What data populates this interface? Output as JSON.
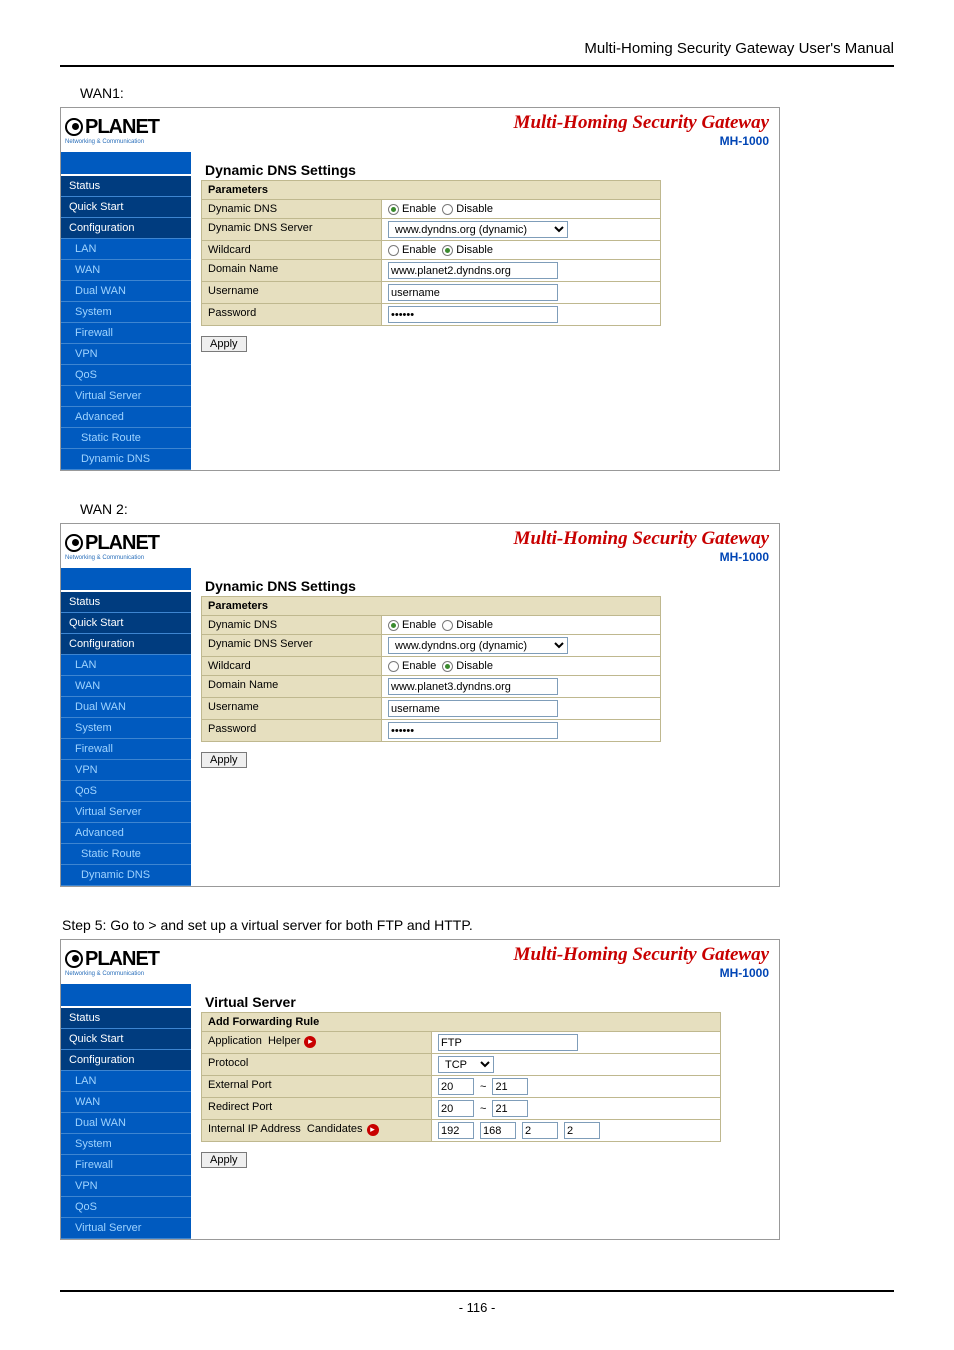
{
  "doc": {
    "header": "Multi-Homing Security Gateway User's Manual",
    "footer": "- 116 -"
  },
  "product": {
    "brand": "PLANET",
    "tagline": "Networking & Communication",
    "title": "Multi-Homing Security Gateway",
    "model": "MH-1000"
  },
  "nav": {
    "status": "Status",
    "quickstart": "Quick Start",
    "configuration": "Configuration",
    "lan": "LAN",
    "wan": "WAN",
    "dualwan": "Dual WAN",
    "system": "System",
    "firewall": "Firewall",
    "vpn": "VPN",
    "qos": "QoS",
    "virtualserver": "Virtual Server",
    "advanced": "Advanced",
    "staticroute": "Static Route",
    "dynamicdns": "Dynamic DNS"
  },
  "labels": {
    "wan1": "WAN1:",
    "wan2": "WAN 2:",
    "step5_a": "Step 5: Go to ",
    "step5_b": " > ",
    "step5_c": " and set up a virtual server for both FTP and HTTP."
  },
  "ddns": {
    "panel_title": "Dynamic DNS Settings",
    "parameters": "Parameters",
    "dynamic_dns": "Dynamic DNS",
    "server": "Dynamic DNS Server",
    "wildcard": "Wildcard",
    "domain": "Domain Name",
    "username": "Username",
    "password": "Password",
    "enable": "Enable",
    "disable": "Disable",
    "server_value": "www.dyndns.org (dynamic)",
    "username_value": "username",
    "password_value": "••••••",
    "apply": "Apply"
  },
  "wan1": {
    "domain": "www.planet2.dyndns.org"
  },
  "wan2": {
    "domain": "www.planet3.dyndns.org"
  },
  "vs": {
    "panel_title": "Virtual Server",
    "add_rule": "Add Forwarding Rule",
    "application": "Application",
    "helper": "Helper",
    "protocol": "Protocol",
    "external_port": "External Port",
    "redirect_port": "Redirect Port",
    "internal_ip": "Internal IP Address",
    "candidates": "Candidates",
    "app_value": "FTP",
    "proto_value": "TCP",
    "ext_from": "20",
    "ext_to": "21",
    "red_from": "20",
    "red_to": "21",
    "ip1": "192",
    "ip2": "168",
    "ip3": "2",
    "ip4": "2",
    "apply": "Apply"
  }
}
